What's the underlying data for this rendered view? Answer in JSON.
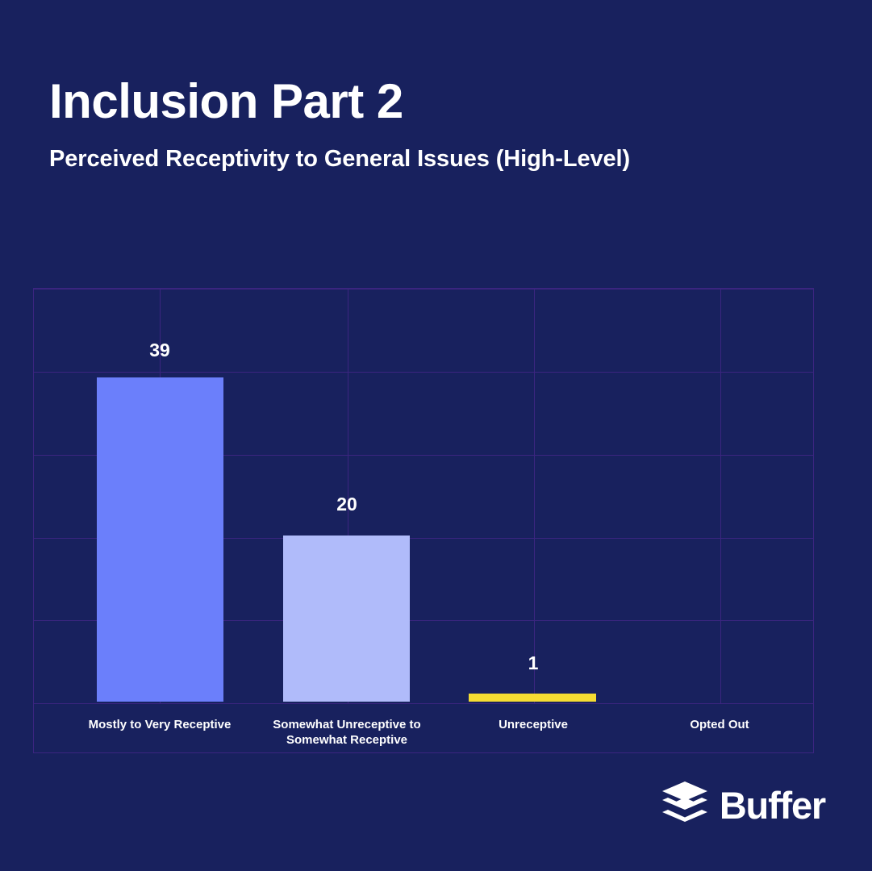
{
  "header": {
    "title": "Inclusion Part 2",
    "subtitle": "Perceived Receptivity to General Issues (High-Level)"
  },
  "brand": {
    "name": "Buffer",
    "mark_icon": "buffer-layers-icon"
  },
  "colors": {
    "background": "#18215e",
    "plot_background": "#18215e",
    "grid": "#3b2580",
    "text": "#ffffff",
    "bar_1": "#6b7ffb",
    "bar_2": "#b0bbfa",
    "bar_3": "#f5dc32",
    "bar_4": "#18215e"
  },
  "chart_data": {
    "type": "bar",
    "title": "Inclusion Part 2",
    "subtitle": "Perceived Receptivity to General Issues (High-Level)",
    "xlabel": "",
    "ylabel": "",
    "ylim": [
      0,
      50
    ],
    "grid": true,
    "legend": "none",
    "gridline_values": [
      0,
      10,
      20,
      30,
      40,
      50
    ],
    "categories": [
      "Mostly to Very Receptive",
      "Somewhat Unreceptive to\nSomewhat Receptive",
      "Unreceptive",
      "Opted Out"
    ],
    "values": [
      39,
      20,
      1,
      0
    ],
    "data_labels": [
      "39",
      "20",
      "1",
      ""
    ],
    "bar_colors": [
      "#6b7ffb",
      "#b0bbfa",
      "#f5dc32",
      "#18215e"
    ]
  }
}
